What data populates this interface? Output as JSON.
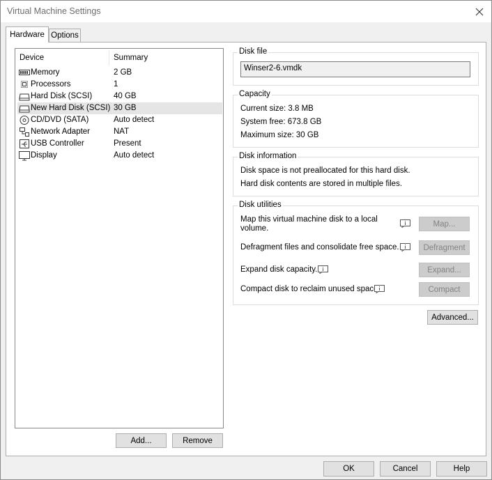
{
  "window": {
    "title": "Virtual Machine Settings"
  },
  "tabs": [
    {
      "label": "Hardware",
      "active": true
    },
    {
      "label": "Options",
      "active": false
    }
  ],
  "device_list": {
    "headers": {
      "device": "Device",
      "summary": "Summary"
    },
    "rows": [
      {
        "name": "Memory",
        "summary": "2 GB",
        "icon": "memory-icon"
      },
      {
        "name": "Processors",
        "summary": "1",
        "icon": "processor-icon"
      },
      {
        "name": "Hard Disk (SCSI)",
        "summary": "40 GB",
        "icon": "hard-disk-icon"
      },
      {
        "name": "New Hard Disk (SCSI)",
        "summary": "30 GB",
        "icon": "hard-disk-icon",
        "selected": true
      },
      {
        "name": "CD/DVD (SATA)",
        "summary": "Auto detect",
        "icon": "cd-dvd-icon"
      },
      {
        "name": "Network Adapter",
        "summary": "NAT",
        "icon": "network-adapter-icon"
      },
      {
        "name": "USB Controller",
        "summary": "Present",
        "icon": "usb-icon"
      },
      {
        "name": "Display",
        "summary": "Auto detect",
        "icon": "display-icon"
      }
    ],
    "add_label": "Add...",
    "remove_label": "Remove"
  },
  "disk_file": {
    "label": "Disk file",
    "value": "Winser2-6.vmdk"
  },
  "capacity": {
    "label": "Capacity",
    "current_size": "Current size:  3.8 MB",
    "system_free": "System free:  673.8 GB",
    "maximum_size": "Maximum size:  30 GB"
  },
  "disk_information": {
    "label": "Disk information",
    "line1": "Disk space is not preallocated for this hard disk.",
    "line2": "Hard disk contents are stored in multiple files."
  },
  "disk_utilities": {
    "label": "Disk utilities",
    "map_text_1": "Map this virtual machine disk to a local",
    "map_text_2": "volume.",
    "map_button": "Map...",
    "defrag_text": "Defragment files and consolidate free space.",
    "defrag_button": "Defragment",
    "expand_text": "Expand disk capacity.",
    "expand_button": "Expand...",
    "compact_text": "Compact disk to reclaim unused space.",
    "compact_button": "Compact"
  },
  "advanced_label": "Advanced...",
  "footer": {
    "ok": "OK",
    "cancel": "Cancel",
    "help": "Help"
  }
}
